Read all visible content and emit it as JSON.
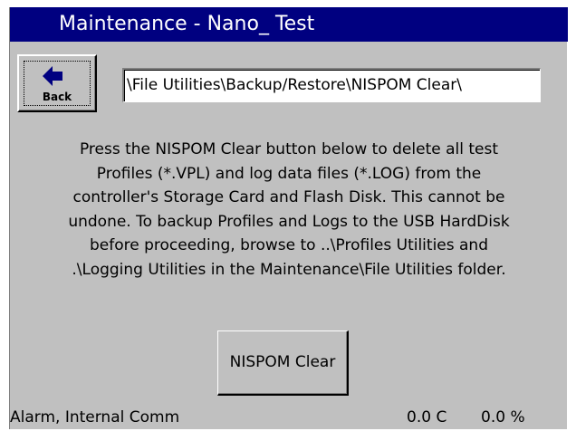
{
  "window": {
    "title": "Maintenance - Nano_ Test"
  },
  "toolbar": {
    "back_label": "Back",
    "back_icon": "arrow-left-icon"
  },
  "path": {
    "value": "\\File Utilities\\Backup/Restore\\NISPOM Clear\\"
  },
  "message": {
    "lines": [
      "Press the NISPOM Clear button below to delete all test",
      "Profiles (*.VPL) and log data files (*.LOG)  from the",
      "controller's Storage Card and Flash Disk.  This cannot be",
      "undone.  To backup Profiles and Logs to the USB HardDisk",
      "before proceeding, browse to ..\\Profiles Utilities and",
      ".\\Logging Utilities in the  Maintenance\\File Utilities folder."
    ]
  },
  "actions": {
    "nispom_clear_label": "NISPOM Clear"
  },
  "status": {
    "alarm": "Alarm, Internal Comm",
    "temperature": "0.0 C",
    "humidity": "0.0 %"
  },
  "colors": {
    "titlebar_bg": "#000080",
    "titlebar_text": "#ffffff",
    "window_bg": "#c0c0c0",
    "field_bg": "#ffffff"
  }
}
